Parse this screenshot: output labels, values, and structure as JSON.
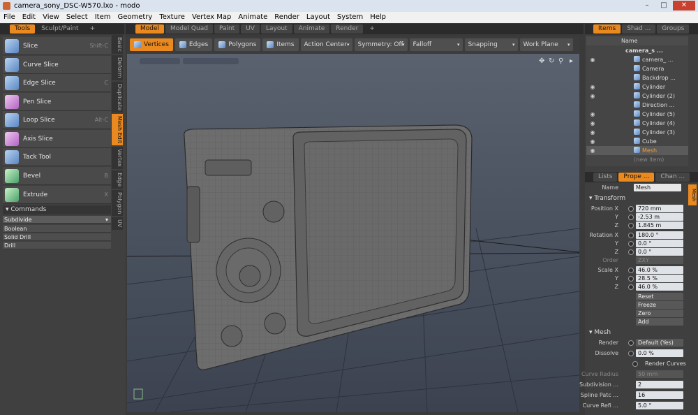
{
  "window": {
    "title": "camera_sony_DSC-W570.lxo - modo"
  },
  "menu": [
    "File",
    "Edit",
    "View",
    "Select",
    "Item",
    "Geometry",
    "Texture",
    "Vertex Map",
    "Animate",
    "Render",
    "Layout",
    "System",
    "Help"
  ],
  "left_tabs": [
    "Tools",
    "Sculpt/Paint",
    "+"
  ],
  "center_tabs": [
    "Model",
    "Model Quad",
    "Paint",
    "UV",
    "Layout",
    "Animate",
    "Render",
    "+"
  ],
  "right_tabs": [
    "Items",
    "Shad ...",
    "Groups"
  ],
  "tools": [
    {
      "label": "Slice",
      "shortcut": "Shift-C",
      "icon": "slice-icon"
    },
    {
      "label": "Curve Slice",
      "shortcut": "",
      "icon": "curve-slice-icon"
    },
    {
      "label": "Edge Slice",
      "shortcut": "C",
      "icon": "edge-slice-icon"
    },
    {
      "label": "Pen Slice",
      "shortcut": "",
      "icon": "pen-slice-icon"
    },
    {
      "label": "Loop Slice",
      "shortcut": "Alt-C",
      "icon": "loop-slice-icon"
    },
    {
      "label": "Axis Slice",
      "shortcut": "",
      "icon": "axis-slice-icon"
    },
    {
      "label": "Tack Tool",
      "shortcut": "",
      "icon": "tack-tool-icon"
    },
    {
      "label": "Bevel",
      "shortcut": "B",
      "icon": "bevel-icon"
    },
    {
      "label": "Extrude",
      "shortcut": "X",
      "icon": "extrude-icon"
    }
  ],
  "vertical_tabs": [
    "Basic",
    "Deform",
    "Duplicate",
    "Mesh Edit",
    "Vertex",
    "Edge",
    "Polygon",
    "UV"
  ],
  "commands": {
    "header": "Commands",
    "dropdown": "Subdivide",
    "items": [
      "Boolean",
      "Solid Drill",
      "Drill"
    ]
  },
  "view_toolbar": {
    "modes": [
      "Vertices",
      "Edges",
      "Polygons",
      "Items"
    ],
    "action_center": "Action Center",
    "symmetry": "Symmetry: Off",
    "falloff": "Falloff",
    "snapping": "Snapping",
    "work_plane": "Work Plane"
  },
  "items_header": "Name",
  "items": [
    {
      "label": "camera_s ...",
      "eye": false,
      "root": true
    },
    {
      "label": "camera_ ...",
      "eye": true
    },
    {
      "label": "Camera",
      "eye": false
    },
    {
      "label": "Backdrop ...",
      "eye": false
    },
    {
      "label": "Cylinder",
      "eye": true
    },
    {
      "label": "Cylinder (2)",
      "eye": true
    },
    {
      "label": "Direction ...",
      "eye": false
    },
    {
      "label": "Cylinder (5)",
      "eye": true
    },
    {
      "label": "Cylinder (4)",
      "eye": true
    },
    {
      "label": "Cylinder (3)",
      "eye": true
    },
    {
      "label": "Cube",
      "eye": true
    },
    {
      "label": "Mesh",
      "eye": true,
      "selected": true
    },
    {
      "label": "(new item)",
      "eye": false,
      "dim": true
    }
  ],
  "props_tabs": [
    "Lists",
    "Prope ...",
    "Chan ..."
  ],
  "props": {
    "name_label": "Name",
    "name_value": "Mesh",
    "side_tab": "Mesh",
    "transform_header": "Transform",
    "position_label": "Position X",
    "position": [
      "720 mm",
      "-2.53 m",
      "1.845 m"
    ],
    "rotation_label": "Rotation X",
    "rotation": [
      "180.0 °",
      "0.0 °",
      "0.0 °"
    ],
    "order_label": "Order",
    "order": "ZXY",
    "scale_label": "Scale X",
    "scale": [
      "46.0 %",
      "28.5 %",
      "46.0 %"
    ],
    "axes": [
      "Y",
      "Z"
    ],
    "actions": [
      "Reset",
      "Freeze",
      "Zero",
      "Add"
    ],
    "mesh_header": "Mesh",
    "render_label": "Render",
    "render": "Default (Yes)",
    "dissolve_label": "Dissolve",
    "dissolve": "0.0 %",
    "render_curves": "Render Curves",
    "curve_radius_label": "Curve Radius",
    "curve_radius": "50 mm",
    "subdiv_label": "Subdivision ...",
    "subdiv": "2",
    "spline_label": "Spline Patc ...",
    "spline": "16",
    "curve_ref_label": "Curve Refi ...",
    "curve_ref": "5.0 °"
  },
  "colors": {
    "accent": "#e9891f",
    "viewport_top": "#5a6270",
    "viewport_bottom": "#3c4250"
  }
}
